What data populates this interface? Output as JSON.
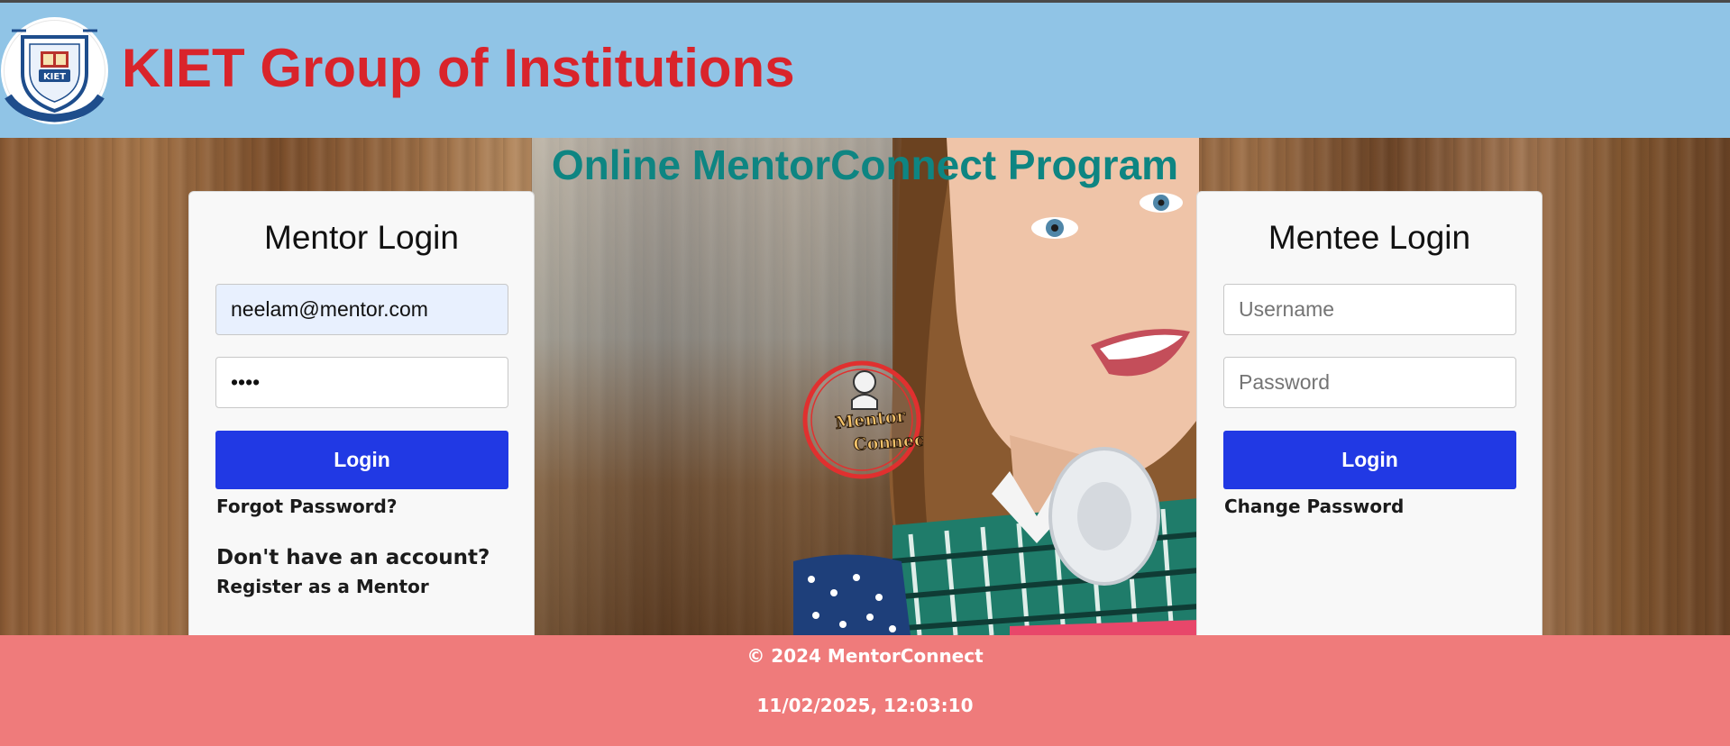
{
  "header": {
    "logo_alt": "KIET GROUP OF INSTITUTIONS",
    "logo_inner_text": "KIET",
    "title": "KIET Group of Institutions"
  },
  "hero": {
    "program_title": "Online MentorConnect Program",
    "badge_line1": "Mentor",
    "badge_line2": "Connect"
  },
  "mentor_login": {
    "heading": "Mentor Login",
    "username_value": "neelam@mentor.com",
    "password_value": "abcd",
    "login_label": "Login",
    "forgot_label": "Forgot Password?",
    "no_account_text": "Don't have an account?",
    "register_label": "Register as a Mentor"
  },
  "mentee_login": {
    "heading": "Mentee Login",
    "username_placeholder": "Username",
    "password_placeholder": "Password",
    "login_label": "Login",
    "change_password_label": "Change Password"
  },
  "footer": {
    "copyright": "© 2024 MentorConnect",
    "datetime": "11/02/2025, 12:03:10"
  },
  "colors": {
    "header_bg": "#90c4e6",
    "title_red": "#d9242b",
    "program_teal": "#0e8582",
    "button_blue": "#2139e4",
    "footer_bg": "#ef7b7b",
    "autofill_bg": "#e8f0fe"
  }
}
